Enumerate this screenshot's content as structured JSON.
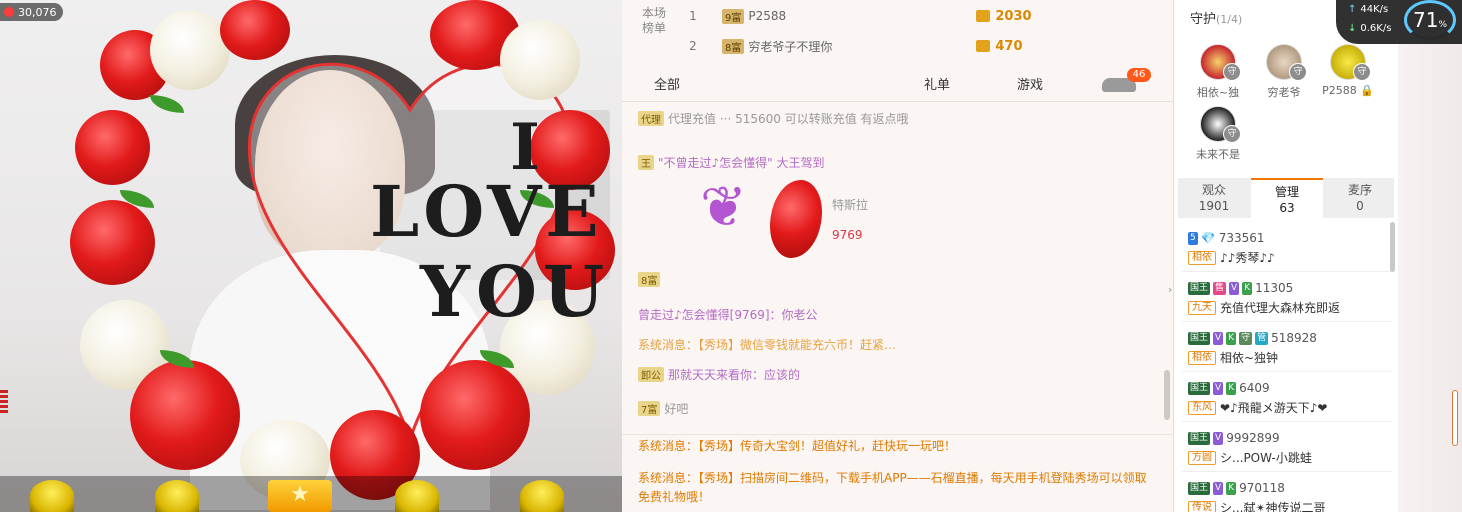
{
  "video": {
    "viewer_count": "30,076",
    "overlay_text": {
      "line1": "I",
      "line2": "LOVE",
      "line3": "YOU"
    }
  },
  "rank": {
    "title": "本场榜单",
    "rows": [
      {
        "no": "1",
        "level": "9富",
        "name": "P2588",
        "value": "2030"
      },
      {
        "no": "2",
        "level": "8富",
        "name": "穷老爷子不理你",
        "value": "470"
      }
    ]
  },
  "chat_tabs": {
    "all": "全部",
    "gift": "礼单",
    "game": "游戏",
    "badge": "46"
  },
  "chat": {
    "messages": [
      {
        "tag": "代理",
        "text": "代理充值 ··· 515600 可以转账充值 有返点哦"
      },
      {
        "tag": "王",
        "text": "\"不曾走过♪怎会懂得\" 大王驾到"
      },
      {
        "tag": "",
        "text": "特斯拉"
      },
      {
        "tag": "",
        "text": "9769"
      },
      {
        "tag": "8富",
        "text": ""
      },
      {
        "tag": "",
        "text": "曾走过♪怎会懂得[9769]：你老公"
      },
      {
        "tag": "",
        "text": "系统消息：【秀场】微信零钱就能充六币！赶紧…"
      },
      {
        "tag": "卸公",
        "text": "那就天天来看你：应该的"
      },
      {
        "tag": "7富",
        "text": "好吧"
      }
    ]
  },
  "system": {
    "msg1": "系统消息：【秀场】传奇大宝剑！超值好礼，赶快玩一玩吧！",
    "msg2": "系统消息：【秀场】扫描房间二维码，下载手机APP——石榴直播，每天用手机登陆秀场可以领取免费礼物哦！"
  },
  "guard": {
    "title": "守护",
    "count": "(1/4)",
    "members": [
      {
        "name": "相依~独"
      },
      {
        "name": "穷老爷"
      },
      {
        "name": "P2588"
      },
      {
        "name": "未来不是"
      }
    ]
  },
  "side_tabs": [
    {
      "label": "观众",
      "count": "1901"
    },
    {
      "label": "管理",
      "count": "63"
    },
    {
      "label": "麦序",
      "count": "0"
    }
  ],
  "audience": [
    {
      "id": "733561",
      "group": "相依",
      "nick": "♪♪秀琴♪♪",
      "badges": [
        "5"
      ]
    },
    {
      "id": "11305",
      "group": "九天",
      "nick": "充值代理大森林充即返",
      "badges": [
        "国王",
        "售",
        "V",
        "K"
      ]
    },
    {
      "id": "518928",
      "group": "相依",
      "nick": "相依~独钟",
      "badges": [
        "国王",
        "V",
        "K",
        "守",
        "管"
      ]
    },
    {
      "id": "6409",
      "group": "东风",
      "nick": "❤♪飛龍メ游天下♪❤",
      "badges": [
        "国王",
        "V",
        "K"
      ]
    },
    {
      "id": "9992899",
      "group": "方圆",
      "nick": "シ...POW-小跳蛙",
      "badges": [
        "国王",
        "V"
      ]
    },
    {
      "id": "970118",
      "group": "传说",
      "nick": "シ...弑✴神传说二哥",
      "badges": [
        "国王",
        "V",
        "K"
      ]
    }
  ],
  "network": {
    "up": "44K/s",
    "down": "0.6K/s",
    "percent": "71",
    "percent_unit": "%"
  },
  "colors": {
    "accent": "#f07800",
    "system_msg": "#e07a00",
    "rank_value": "#d98a00"
  }
}
